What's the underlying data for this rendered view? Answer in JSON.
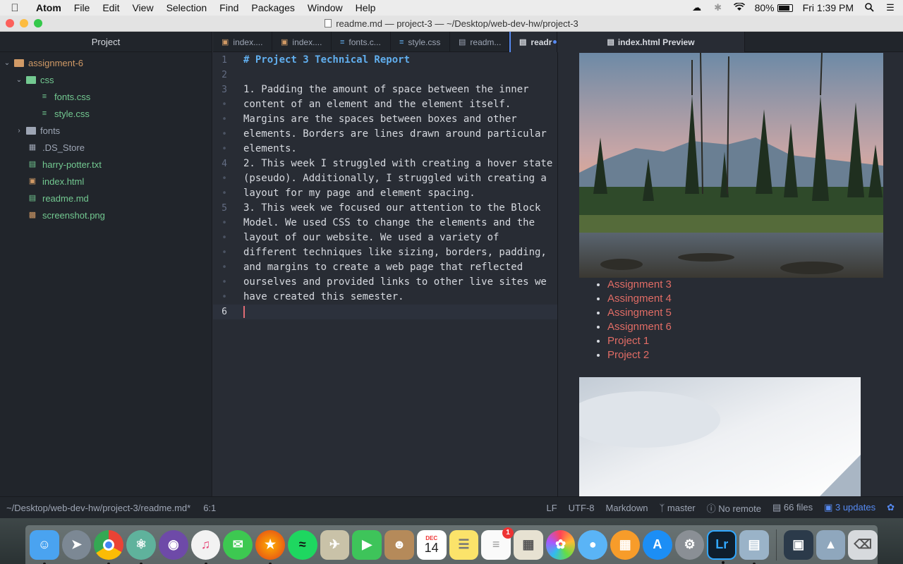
{
  "menubar": {
    "app_name": "Atom",
    "items": [
      "File",
      "Edit",
      "View",
      "Selection",
      "Find",
      "Packages",
      "Window",
      "Help"
    ],
    "battery": "80%",
    "clock": "Fri 1:39 PM"
  },
  "window": {
    "title": "readme.md — project-3 — ~/Desktop/web-dev-hw/project-3"
  },
  "tree": {
    "header": "Project",
    "root": "assignment-6",
    "css_folder": "css",
    "css_files": [
      "fonts.css",
      "style.css"
    ],
    "fonts_folder": "fonts",
    "files": [
      ".DS_Store",
      "harry-potter.txt",
      "index.html",
      "readme.md",
      "screenshot.png"
    ]
  },
  "tabs": [
    {
      "label": "index...."
    },
    {
      "label": "index...."
    },
    {
      "label": "fonts.c..."
    },
    {
      "label": "style.css"
    },
    {
      "label": "readm..."
    },
    {
      "label": "readr"
    }
  ],
  "preview_tab": {
    "label": "index.html Preview"
  },
  "editor": {
    "lines": [
      {
        "num": "1",
        "text": "# Project 3 Technical Report",
        "heading": true
      },
      {
        "num": "2",
        "text": ""
      },
      {
        "num": "3",
        "text": "1. Padding the amount of space between the inner"
      },
      {
        "num": "•",
        "text": "content of an element and the element itself."
      },
      {
        "num": "•",
        "text": "Margins are the spaces between boxes and other"
      },
      {
        "num": "•",
        "text": "elements. Borders are lines drawn around particular"
      },
      {
        "num": "•",
        "text": "elements."
      },
      {
        "num": "4",
        "text": "2. This week I struggled with creating a hover state"
      },
      {
        "num": "•",
        "text": "(pseudo). Additionally, I struggled with creating a"
      },
      {
        "num": "•",
        "text": "layout for my page and element spacing."
      },
      {
        "num": "5",
        "text": "3. This week we focused our attention to the Block"
      },
      {
        "num": "•",
        "text": "Model. We used CSS to change the elements and the"
      },
      {
        "num": "•",
        "text": "layout of our website. We used a variety of"
      },
      {
        "num": "•",
        "text": "different techniques like sizing, borders, padding,"
      },
      {
        "num": "•",
        "text": "and margins to create a web page that reflected"
      },
      {
        "num": "•",
        "text": "ourselves and provided links to other live sites we"
      },
      {
        "num": "•",
        "text": "have created this semester."
      },
      {
        "num": "6",
        "text": ""
      }
    ]
  },
  "preview": {
    "links": [
      "Assignment 3",
      "Assingment 4",
      "Assingment 5",
      "Assignment 6",
      "Project 1",
      "Project 2"
    ]
  },
  "statusbar": {
    "path": "~/Desktop/web-dev-hw/project-3/readme.md*",
    "cursor": "6:1",
    "line_ending": "LF",
    "encoding": "UTF-8",
    "grammar": "Markdown",
    "branch": "master",
    "remote": "No remote",
    "files": "66 files",
    "updates": "3 updates"
  },
  "dock": {
    "calendar_month": "DEC",
    "calendar_day": "14",
    "reminders_badge": "1",
    "lightroom_label": "Lr"
  },
  "colors": {
    "accent": "#568af2",
    "link": "#e06c65",
    "git_added": "#73c991",
    "git_modified": "#d19a66"
  }
}
